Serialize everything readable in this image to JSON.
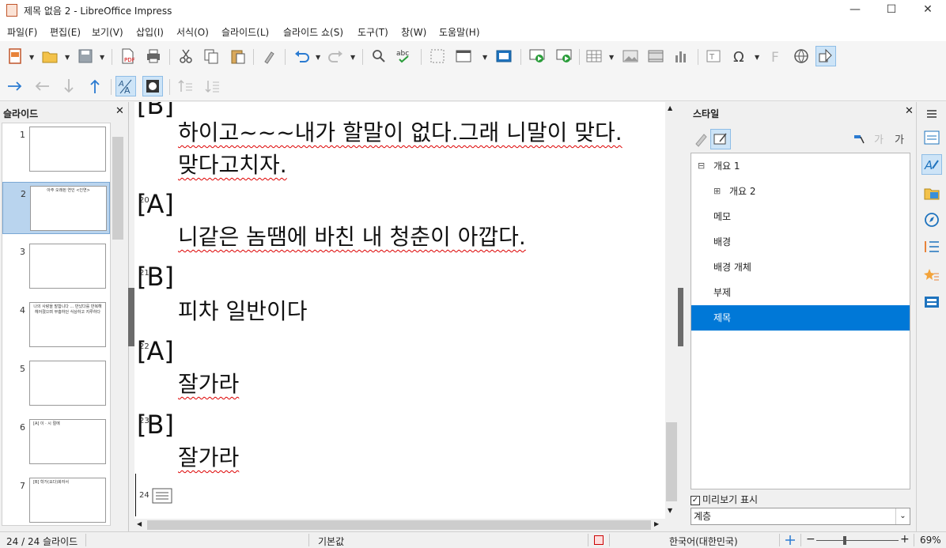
{
  "window": {
    "title": "제목 없음 2 - LibreOffice Impress",
    "minimize": "—",
    "maximize": "☐",
    "close": "✕"
  },
  "menu": [
    "파일(F)",
    "편집(E)",
    "보기(V)",
    "삽입(I)",
    "서식(O)",
    "슬라이드(L)",
    "슬라이드 쇼(S)",
    "도구(T)",
    "창(W)",
    "도움말(H)"
  ],
  "slide_pane": {
    "title": "슬라이드",
    "close": "✕",
    "thumbs": [
      {
        "num": "1",
        "text": ""
      },
      {
        "num": "2",
        "text": "아주 오래된 연인 <인연>"
      },
      {
        "num": "3",
        "text": ""
      },
      {
        "num": "4",
        "text": "나의 사랑을 말합니다 ... 만났다를 반복해 헤어졌으며 부흥하던 식상하고 지루하다"
      },
      {
        "num": "5",
        "text": ""
      },
      {
        "num": "6",
        "text": "[A] 이 · 시 절에"
      },
      {
        "num": "7",
        "text": "[B] 학가(요다)화자서"
      }
    ]
  },
  "outline": [
    {
      "num": "",
      "speaker": "[B]",
      "text": "하이고~~~내가 할말이 없다.그래 니말이 맞다.",
      "text2": "맞다고치자."
    },
    {
      "num": "20",
      "speaker": "[A]",
      "text": "니같은 놈땜에 바친 내 청춘이 아깝다."
    },
    {
      "num": "21",
      "speaker": "[B]",
      "text": "피차 일반이다"
    },
    {
      "num": "22",
      "speaker": "[A]",
      "text": "잘가라"
    },
    {
      "num": "23",
      "speaker": "[B]",
      "text": "잘가라"
    },
    {
      "num": "24"
    }
  ],
  "style_pane": {
    "title": "스타일",
    "close": "✕",
    "items": [
      {
        "label": "개요 1",
        "expander": "⊟"
      },
      {
        "label": "개요 2",
        "expander": "⊞"
      },
      {
        "label": "메모"
      },
      {
        "label": "배경"
      },
      {
        "label": "배경 개체"
      },
      {
        "label": "부제"
      },
      {
        "label": "제목",
        "selected": true
      }
    ],
    "preview_label": "미리보기 표시",
    "preview_checked": "✓",
    "filter_value": "계층"
  },
  "status": {
    "slide_count": "24 / 24 슬라이드",
    "master": "기본값",
    "language": "한국어(대한민국)",
    "zoom_minus": "−",
    "zoom_plus": "+",
    "zoom": "69%"
  },
  "colors": {
    "accent": "#0078d7",
    "selection": "#b9d4ee",
    "spell": "#d00000"
  }
}
